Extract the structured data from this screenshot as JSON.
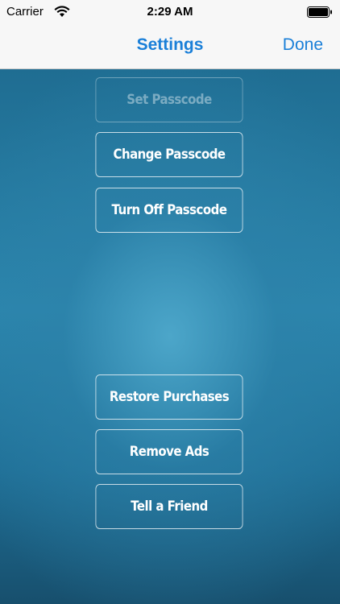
{
  "status_bar": {
    "carrier": "Carrier",
    "time": "2:29 AM",
    "wifi_icon": "wifi-icon",
    "battery_icon": "battery-icon"
  },
  "nav": {
    "title": "Settings",
    "done_label": "Done",
    "accent_color": "#1a7fd8"
  },
  "buttons": {
    "set_passcode": "Set Passcode",
    "change_passcode": "Change Passcode",
    "turn_off_passcode": "Turn Off Passcode",
    "restore_purchases": "Restore Purchases",
    "remove_ads": "Remove Ads",
    "tell_a_friend": "Tell a Friend"
  },
  "colors": {
    "background": "#2b86ad",
    "button_border": "#ffffff"
  }
}
